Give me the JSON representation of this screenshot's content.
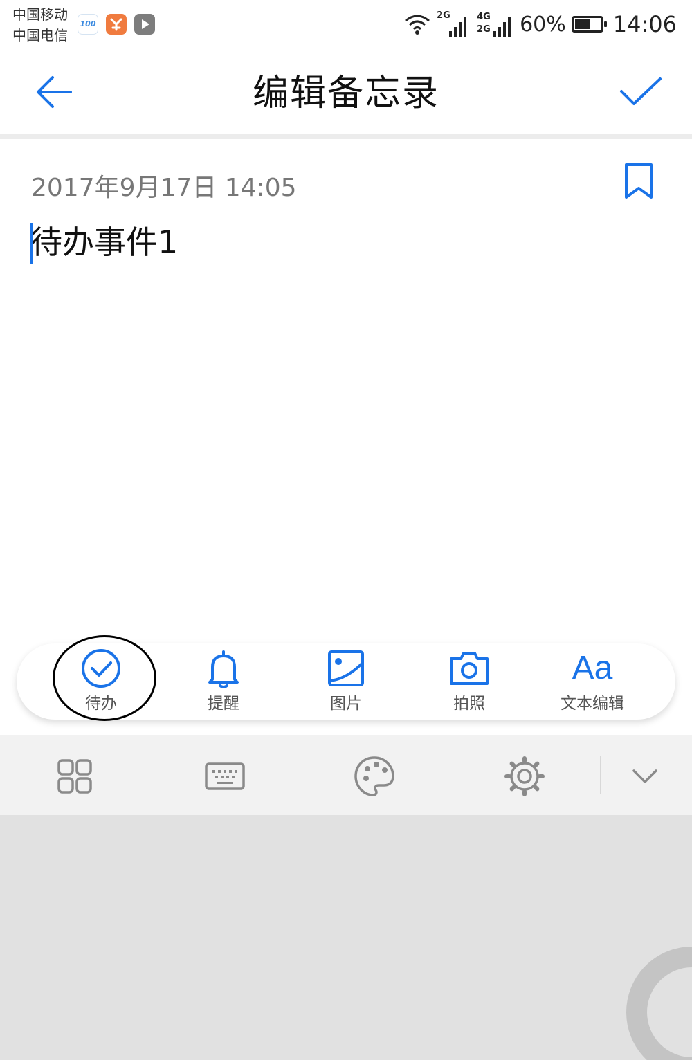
{
  "status_bar": {
    "carrier_1": "中国移动",
    "carrier_2": "中国电信",
    "app_badge_text": "100",
    "network_1": "2G",
    "network_2": "4G",
    "network_3": "2G",
    "battery_percent_label": "60%",
    "battery_level": 0.6,
    "time": "14:06"
  },
  "header": {
    "title": "编辑备忘录",
    "back_icon": "arrow-left-icon",
    "confirm_icon": "check-icon"
  },
  "note": {
    "date": "2017年9月17日 14:05",
    "body": "待办事件1",
    "bookmark_icon": "bookmark-icon"
  },
  "toolbar": {
    "items": [
      {
        "label": "待办",
        "icon": "check-circle-icon"
      },
      {
        "label": "提醒",
        "icon": "bell-icon"
      },
      {
        "label": "图片",
        "icon": "image-icon"
      },
      {
        "label": "拍照",
        "icon": "camera-icon"
      },
      {
        "label": "文本编辑",
        "icon": "text-format-icon",
        "glyph": "Aa"
      }
    ]
  },
  "keyboard_bar": {
    "icons": [
      "grid-icon",
      "keyboard-icon",
      "palette-icon",
      "settings-icon",
      "chevron-down-icon"
    ]
  },
  "colors": {
    "accent": "#1a73e8",
    "text_primary": "#111111",
    "text_secondary": "#777777",
    "keyboard_strip": "#f2f2f2",
    "keyboard_area": "#e1e1e1"
  }
}
